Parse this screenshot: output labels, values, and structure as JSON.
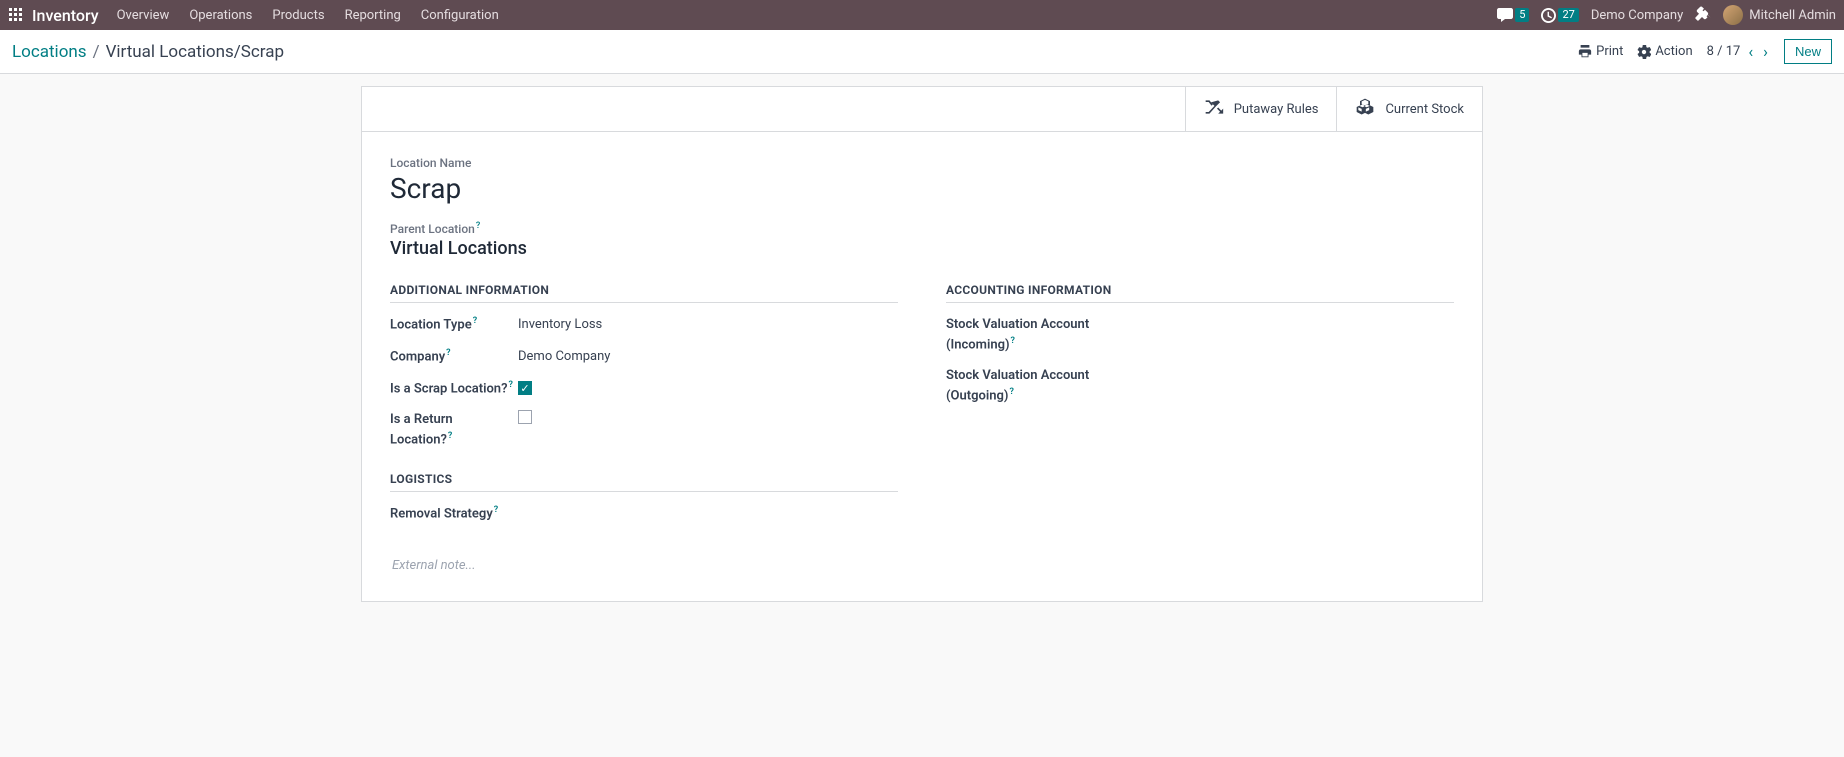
{
  "topbar": {
    "brand": "Inventory",
    "menu": [
      "Overview",
      "Operations",
      "Products",
      "Reporting",
      "Configuration"
    ],
    "messages_count": "5",
    "activities_count": "27",
    "company": "Demo Company",
    "user_name": "Mitchell Admin"
  },
  "breadcrumb": {
    "parent": "Locations",
    "current": "Virtual Locations/Scrap"
  },
  "toolbar": {
    "print": "Print",
    "action": "Action",
    "pager": "8 / 17",
    "new": "New"
  },
  "stat_buttons": {
    "putaway": "Putaway Rules",
    "current_stock": "Current Stock"
  },
  "form": {
    "name_label": "Location Name",
    "name_value": "Scrap",
    "parent_label": "Parent Location",
    "parent_value": "Virtual Locations",
    "sections": {
      "additional": "ADDITIONAL INFORMATION",
      "accounting": "ACCOUNTING INFORMATION",
      "logistics": "LOGISTICS"
    },
    "fields": {
      "location_type_label": "Location Type",
      "location_type_value": "Inventory Loss",
      "company_label": "Company",
      "company_value": "Demo Company",
      "scrap_label": "Is a Scrap Location?",
      "scrap_value": true,
      "return_label": "Is a Return Location?",
      "return_value": false,
      "valuation_in_label": "Stock Valuation Account (Incoming)",
      "valuation_out_label": "Stock Valuation Account (Outgoing)",
      "removal_label": "Removal Strategy"
    },
    "note_placeholder": "External note..."
  }
}
